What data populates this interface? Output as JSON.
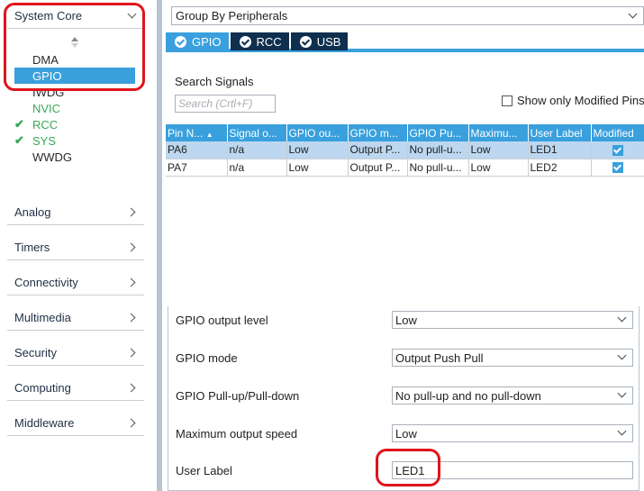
{
  "sidebar": {
    "system_core": {
      "label": "System Core",
      "peripherals": [
        {
          "label": "DMA",
          "checked": false,
          "selected": false,
          "enabled": false
        },
        {
          "label": "GPIO",
          "checked": false,
          "selected": true,
          "enabled": false
        },
        {
          "label": "IWDG",
          "checked": false,
          "selected": false,
          "enabled": false
        },
        {
          "label": "NVIC",
          "checked": false,
          "selected": false,
          "enabled": true
        },
        {
          "label": "RCC",
          "checked": true,
          "selected": false,
          "enabled": true
        },
        {
          "label": "SYS",
          "checked": true,
          "selected": false,
          "enabled": true
        },
        {
          "label": "WWDG",
          "checked": false,
          "selected": false,
          "enabled": false
        }
      ]
    },
    "categories": [
      "Analog",
      "Timers",
      "Connectivity",
      "Multimedia",
      "Security",
      "Computing",
      "Middleware"
    ]
  },
  "groupby": {
    "value": "Group By Peripherals"
  },
  "tabs": [
    {
      "label": "GPIO",
      "active": true
    },
    {
      "label": "RCC",
      "active": false
    },
    {
      "label": "USB",
      "active": false
    }
  ],
  "search": {
    "label": "Search Signals",
    "placeholder": "Search (Crtl+F)"
  },
  "show_modified": {
    "label": "Show only Modified Pins",
    "checked": false
  },
  "table": {
    "columns": [
      "Pin N...",
      "Signal o...",
      "GPIO ou...",
      "GPIO m...",
      "GPIO Pu...",
      "Maximu...",
      "User Label",
      "Modified"
    ],
    "rows": [
      {
        "cells": [
          "PA6",
          "n/a",
          "Low",
          "Output P...",
          "No pull-u...",
          "Low",
          "LED1"
        ],
        "modified": true,
        "selected": true
      },
      {
        "cells": [
          "PA7",
          "n/a",
          "Low",
          "Output P...",
          "No pull-u...",
          "Low",
          "LED2"
        ],
        "modified": true,
        "selected": false
      }
    ]
  },
  "config": {
    "output_level": {
      "label": "GPIO output level",
      "value": "Low"
    },
    "mode": {
      "label": "GPIO mode",
      "value": "Output Push Pull"
    },
    "pull": {
      "label": "GPIO Pull-up/Pull-down",
      "value": "No pull-up and no pull-down"
    },
    "speed": {
      "label": "Maximum output speed",
      "value": "Low"
    },
    "user_label": {
      "label": "User Label",
      "value": "LED1"
    }
  },
  "colors": {
    "accent": "#39a0dd",
    "dark_tab": "#0f2f4e",
    "enabled_green": "#3aa655",
    "highlight_red": "#e0141b"
  }
}
